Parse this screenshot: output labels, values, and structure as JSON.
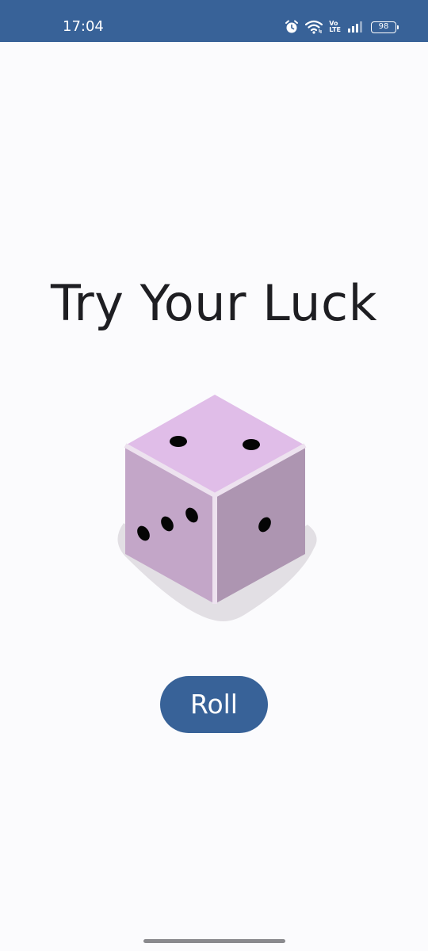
{
  "status_bar": {
    "time": "17:04",
    "battery_level": "98",
    "volte_top": "Vo",
    "volte_bottom": "LTE",
    "icons": [
      "alarm-icon",
      "wifi-icon",
      "volte-icon",
      "signal-icon",
      "battery-icon"
    ],
    "background_color": "#386298"
  },
  "main": {
    "title": "Try Your Luck",
    "dice": {
      "top_face_pips": 2,
      "left_face_pips": 3,
      "right_face_pips": 1,
      "top_color": "#e0bde8",
      "left_color": "#c3a6c8",
      "right_color": "#ad95b1"
    },
    "roll_button_label": "Roll"
  },
  "colors": {
    "accent": "#386298",
    "background": "#fbfbfd",
    "title_text": "#1e1e22"
  }
}
